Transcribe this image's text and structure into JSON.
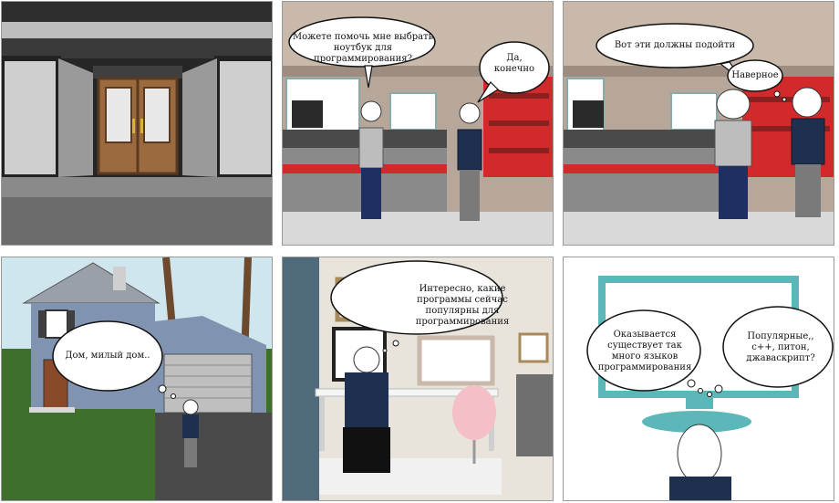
{
  "panels": [
    {
      "id": 1,
      "scene": "storefront",
      "speech": []
    },
    {
      "id": 2,
      "scene": "store",
      "speech": [
        "Можете помочь мне выбрать ноутбук для программирования?",
        "Да, конечно"
      ]
    },
    {
      "id": 3,
      "scene": "store",
      "speech": [
        "Вот эти должны подойти",
        "Наверное"
      ]
    },
    {
      "id": 4,
      "scene": "house",
      "speech": [
        "Дом, милый дом.."
      ]
    },
    {
      "id": 5,
      "scene": "office",
      "speech": [
        "Интересно, какие программы сейчас популярны для программирования"
      ]
    },
    {
      "id": 6,
      "scene": "thoughts",
      "speech": [
        "Оказывается существует так много языков программирования",
        "Популярные,, с++, питон, джаваскрипт?"
      ]
    }
  ],
  "colors": {
    "background": "#ffffff",
    "panel_border": "#9a9a9a",
    "navy_shirt": "#1f2f4f",
    "store_red": "#d2292a",
    "house_blue": "#8093b1"
  }
}
